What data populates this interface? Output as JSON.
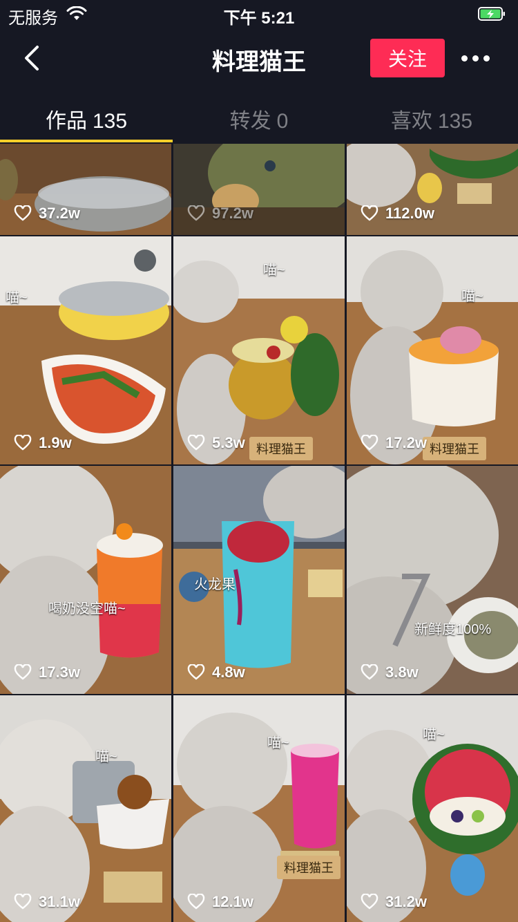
{
  "status_bar": {
    "carrier": "无服务",
    "time": "下午 5:21"
  },
  "nav": {
    "title": "料理猫王",
    "follow_label": "关注"
  },
  "tabs": [
    {
      "label": "作品",
      "count": "135",
      "active": true
    },
    {
      "label": "转发",
      "count": "0",
      "active": false
    },
    {
      "label": "喜欢",
      "count": "135",
      "active": false
    }
  ],
  "colors": {
    "background": "#161823",
    "follow_button": "#fe2c55",
    "tab_indicator": "#facf2a"
  },
  "videos": [
    {
      "likes": "37.2w"
    },
    {
      "likes": "97.2w"
    },
    {
      "likes": "112.0w"
    },
    {
      "likes": "1.9w",
      "caption": "喵~"
    },
    {
      "likes": "5.3w",
      "caption": "喵~",
      "sign": "料理猫王"
    },
    {
      "likes": "17.2w",
      "caption": "喵~",
      "sign": "料理猫王"
    },
    {
      "likes": "17.3w",
      "caption": "喝奶没空喵~"
    },
    {
      "likes": "4.8w",
      "caption": "火龙果"
    },
    {
      "likes": "3.8w",
      "caption": "新鲜度100%"
    },
    {
      "likes": "31.1w",
      "caption": "喵~"
    },
    {
      "likes": "12.1w",
      "caption": "喵~",
      "sign": "料理猫王"
    },
    {
      "likes": "31.2w",
      "caption": "喵~"
    }
  ]
}
